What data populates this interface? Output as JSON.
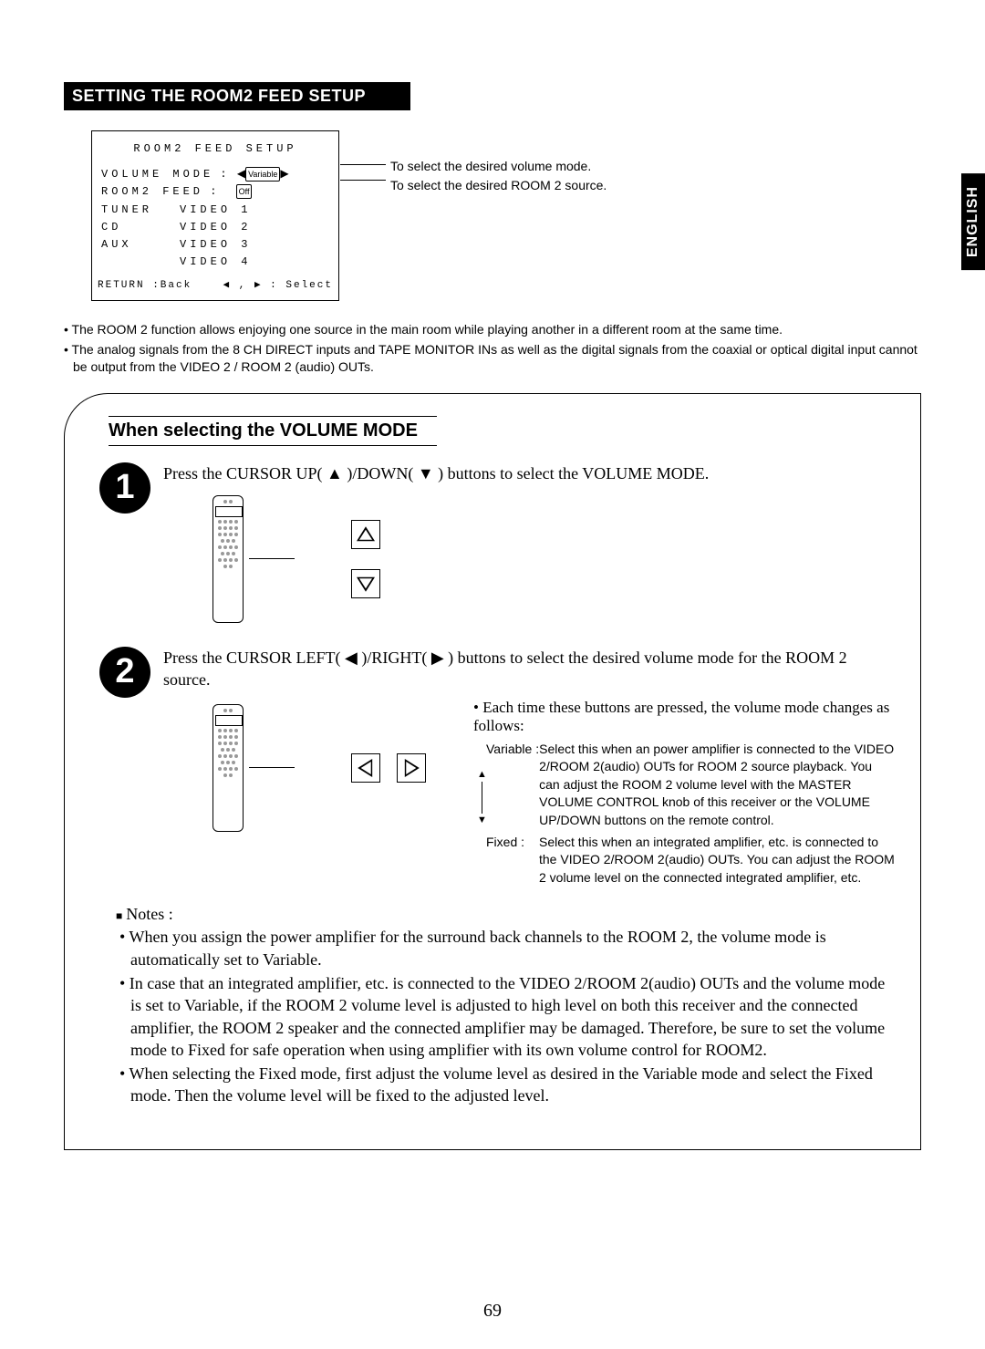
{
  "lang": "ENGLISH",
  "title": "SETTING THE ROOM2 FEED SETUP",
  "osd": {
    "header": "ROOM2 FEED SETUP",
    "row1_label": "VOLUME MODE",
    "row1_value": "Variable",
    "row2_label": "ROOM2 FEED",
    "row2_value": "Off",
    "col_left": [
      "TUNER",
      "CD",
      "AUX",
      ""
    ],
    "col_right": [
      "VIDEO 1",
      "VIDEO 2",
      "VIDEO 3",
      "VIDEO 4"
    ],
    "return": "RETURN :Back",
    "select": "◀ , ▶ : Select"
  },
  "osd_desc": {
    "line1": "To select the desired volume mode.",
    "line2": "To select the desired ROOM 2 source."
  },
  "intro_bullets": [
    "• The ROOM 2 function allows enjoying one source in the main room while playing another in a different room at the same time.",
    "• The analog signals from the 8 CH DIRECT inputs and TAPE MONITOR INs as well as the digital signals from the coaxial or optical digital input cannot be output from the VIDEO 2 / ROOM 2 (audio) OUTs."
  ],
  "sub_title": "When selecting the VOLUME MODE",
  "step1": {
    "num": "1",
    "instr": "Press the CURSOR UP( ▲ )/DOWN( ▼ ) buttons to select the VOLUME MODE."
  },
  "step2": {
    "num": "2",
    "instr": "Press the CURSOR LEFT( ◀ )/RIGHT( ▶ ) buttons to select the desired volume mode for the ROOM 2 source.",
    "cycle": "• Each time these buttons are pressed, the volume mode changes as follows:",
    "modes": [
      {
        "label": "Variable :",
        "text": "Select this when an power amplifier is connected to the VIDEO 2/ROOM 2(audio) OUTs for ROOM 2 source playback. You can adjust the ROOM 2 volume level with the MASTER VOLUME CONTROL knob of this receiver or the VOLUME UP/DOWN buttons on the remote control."
      },
      {
        "label": "Fixed :",
        "text": "Select this when an integrated amplifier, etc. is connected to the VIDEO 2/ROOM 2(audio) OUTs. You can adjust the ROOM 2 volume level on the connected integrated amplifier, etc."
      }
    ]
  },
  "notes_head": "Notes :",
  "notes": [
    "• When you assign the power amplifier for the surround back channels to the ROOM 2, the volume mode is automatically set to Variable.",
    "• In case that an integrated amplifier, etc. is connected to the VIDEO 2/ROOM 2(audio) OUTs and the volume mode is set to Variable, if the ROOM 2 volume level is adjusted to high level on both this receiver and the connected amplifier, the ROOM 2 speaker and the connected amplifier may be damaged. Therefore, be sure to set the volume mode to Fixed for safe operation when using amplifier with its own volume control for ROOM2.",
    "• When selecting the Fixed mode, first adjust the volume level as desired in the Variable mode and select the Fixed mode. Then the volume level will be fixed to the adjusted level."
  ],
  "page_num": "69"
}
